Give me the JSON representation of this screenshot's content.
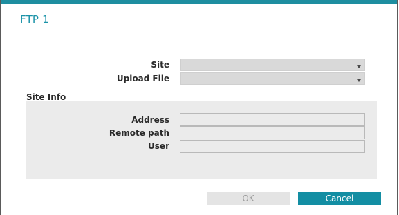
{
  "dialog": {
    "title": "FTP 1",
    "accent_color": "#1b93a8"
  },
  "fields": {
    "site_label": "Site",
    "site_value": "",
    "upload_file_label": "Upload File",
    "upload_file_value": ""
  },
  "site_info": {
    "section_label": "Site Info",
    "address_label": "Address",
    "address_value": "",
    "remote_path_label": "Remote path",
    "remote_path_value": "",
    "user_label": "User",
    "user_value": ""
  },
  "buttons": {
    "ok_label": "OK",
    "ok_enabled": false,
    "cancel_label": "Cancel"
  }
}
